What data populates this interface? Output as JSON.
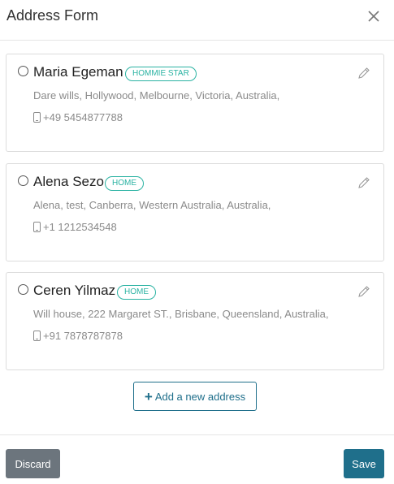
{
  "dialog": {
    "title": "Address Form",
    "close_icon": "close-icon"
  },
  "addresses": [
    {
      "name": "Maria Egeman",
      "tag": "HOMMIE STAR",
      "address": "Dare wills, Hollywood, Melbourne, Victoria, Australia,",
      "phone": "+49 5454877788",
      "selected": false
    },
    {
      "name": "Alena Sezo",
      "tag": "HOME",
      "address": "Alena, test, Canberra, Western Australia, Australia,",
      "phone": "+1 1212534548",
      "selected": false
    },
    {
      "name": "Ceren Yilmaz",
      "tag": "HOME",
      "address": "Will house, 222 Margaret ST., Brisbane, Queensland, Australia,",
      "phone": "+91 7878787878",
      "selected": false
    }
  ],
  "actions": {
    "add_label": "Add a new address",
    "discard_label": "Discard",
    "save_label": "Save"
  },
  "colors": {
    "accent": "#1f6f8b",
    "tag": "#2bb3a3",
    "discard": "#6c757d"
  },
  "icons": {
    "radio": "radio-icon",
    "edit": "pencil-icon",
    "phone": "mobile-phone-icon",
    "add": "plus-icon"
  }
}
